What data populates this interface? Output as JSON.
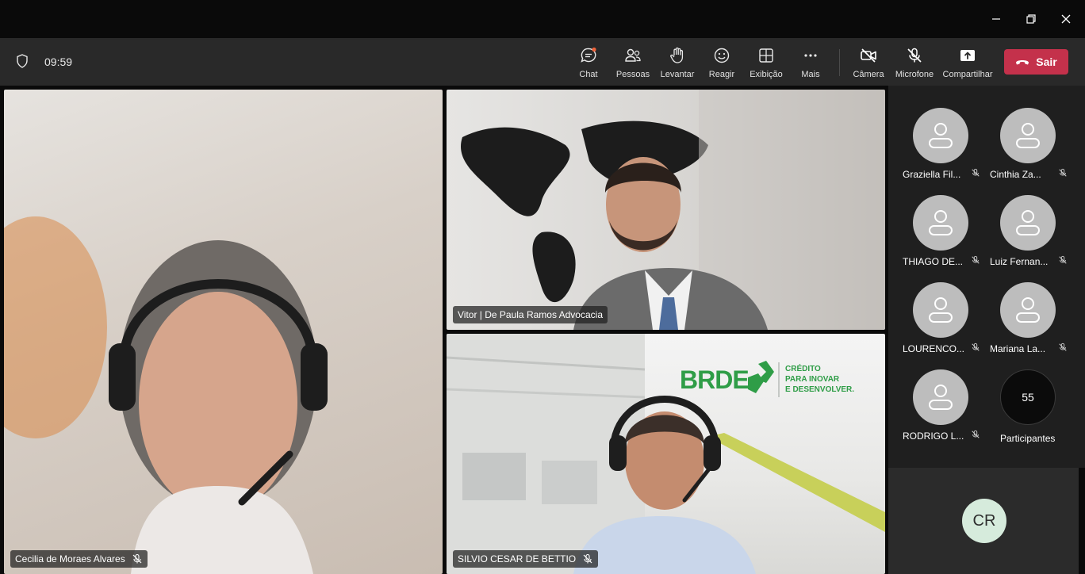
{
  "meeting": {
    "timer": "09:59"
  },
  "toolbar": {
    "chat": "Chat",
    "people": "Pessoas",
    "raise": "Levantar",
    "react": "Reagir",
    "view": "Exibição",
    "more": "Mais",
    "camera": "Câmera",
    "mic": "Microfone",
    "share": "Compartilhar",
    "leave": "Sair"
  },
  "tiles": {
    "main": {
      "name": "Cecilia de Moraes Alvares"
    },
    "top_right": {
      "name": "Vitor | De Paula Ramos Advocacia"
    },
    "bottom_right": {
      "name": "SILVIO CESAR DE BETTIO",
      "logo_brand": "BRDE",
      "logo_line1": "CRÉDITO",
      "logo_line2": "PARA INOVAR",
      "logo_line3": "E DESENVOLVER."
    }
  },
  "participants": [
    {
      "name": "Graziella Fil..."
    },
    {
      "name": "Cinthia Za..."
    },
    {
      "name": "THIAGO DE..."
    },
    {
      "name": "Luiz Fernan..."
    },
    {
      "name": "LOURENCO..."
    },
    {
      "name": "Mariana La..."
    },
    {
      "name": "RODRIGO L..."
    }
  ],
  "overflow": {
    "count": "55",
    "label": "Participantes"
  },
  "self": {
    "initials": "CR"
  },
  "icons": {
    "shield": "shield-icon",
    "chat": "chat-icon",
    "people": "people-icon",
    "raise": "raise-hand-icon",
    "react": "smiley-icon",
    "view": "grid-view-icon",
    "more": "more-dots-icon",
    "camera": "camera-off-icon",
    "mic": "mic-off-icon",
    "share": "share-tray-icon",
    "leave": "phone-hangup-icon"
  },
  "colors": {
    "leave_button": "#c4314b",
    "chat_notification": "#f0633a",
    "self_avatar": "#d6ebdc",
    "brde_green": "#2f9d47"
  }
}
